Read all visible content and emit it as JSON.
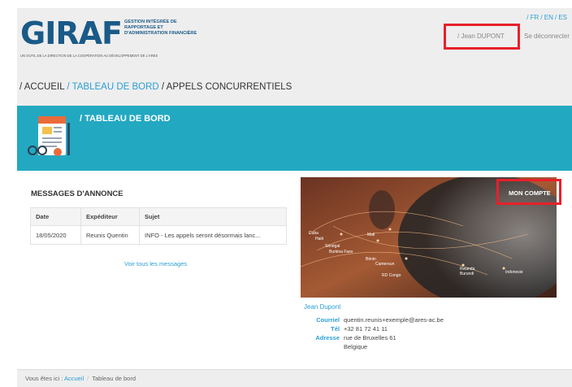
{
  "header": {
    "logo_text": "GIRAF",
    "logo_subtitle": "GESTION INTÉGRÉE DE RAPPORTAGE ET D'ADMINISTRATION FINANCIÈRE",
    "logo_tagline": "UN OUTIL DE LA DIRECTION DE LA COOPÉRATION AU DÉVELOPPEMENT DE L'ARES",
    "languages": [
      "/ FR",
      "/ EN",
      "/ ES"
    ],
    "user_name": "/ Jean DUPONT",
    "logout_label": "Se déconnecter"
  },
  "nav": {
    "items": [
      "/ ACCUEIL",
      "/ TABLEAU DE BORD",
      "/ APPELS CONCURRENTIELS"
    ],
    "active_index": 1
  },
  "banner": {
    "title": "/ TABLEAU DE BORD"
  },
  "messages": {
    "title": "MESSAGES D'ANNONCE",
    "columns": [
      "Date",
      "Expéditeur",
      "Sujet"
    ],
    "rows": [
      [
        "18/05/2020",
        "Reunis Quentin",
        "INFO - Les appels seront désormais lanc..."
      ]
    ],
    "see_all_label": "Voir tous les messages"
  },
  "account": {
    "button_label": "MON COMPTE",
    "photo_labels": [
      "Cuba",
      "Haiti",
      "Sénégal",
      "Burkina Faso",
      "Bénin",
      "Mali",
      "Cameroun",
      "RD Congo",
      "Rwanda",
      "Burundi",
      "Indonesie"
    ],
    "name": "Jean Dupont",
    "fields": [
      {
        "label": "Courriel",
        "value": "quentin.reunis+exemple@ares-ac.be"
      },
      {
        "label": "Tél",
        "value": "+32 81 72 41 11"
      },
      {
        "label": "Adresse",
        "value": "rue de Bruxelles 61"
      },
      {
        "label": "",
        "value": "Belgique"
      }
    ]
  },
  "footer": {
    "prefix": "Vous êtes ici :",
    "crumbs": [
      "Accueil",
      "Tableau de bord"
    ]
  },
  "colors": {
    "accent": "#2a9fd6",
    "banner": "#23a8c2",
    "logo": "#1a5a88",
    "highlight": "#e8202a"
  }
}
